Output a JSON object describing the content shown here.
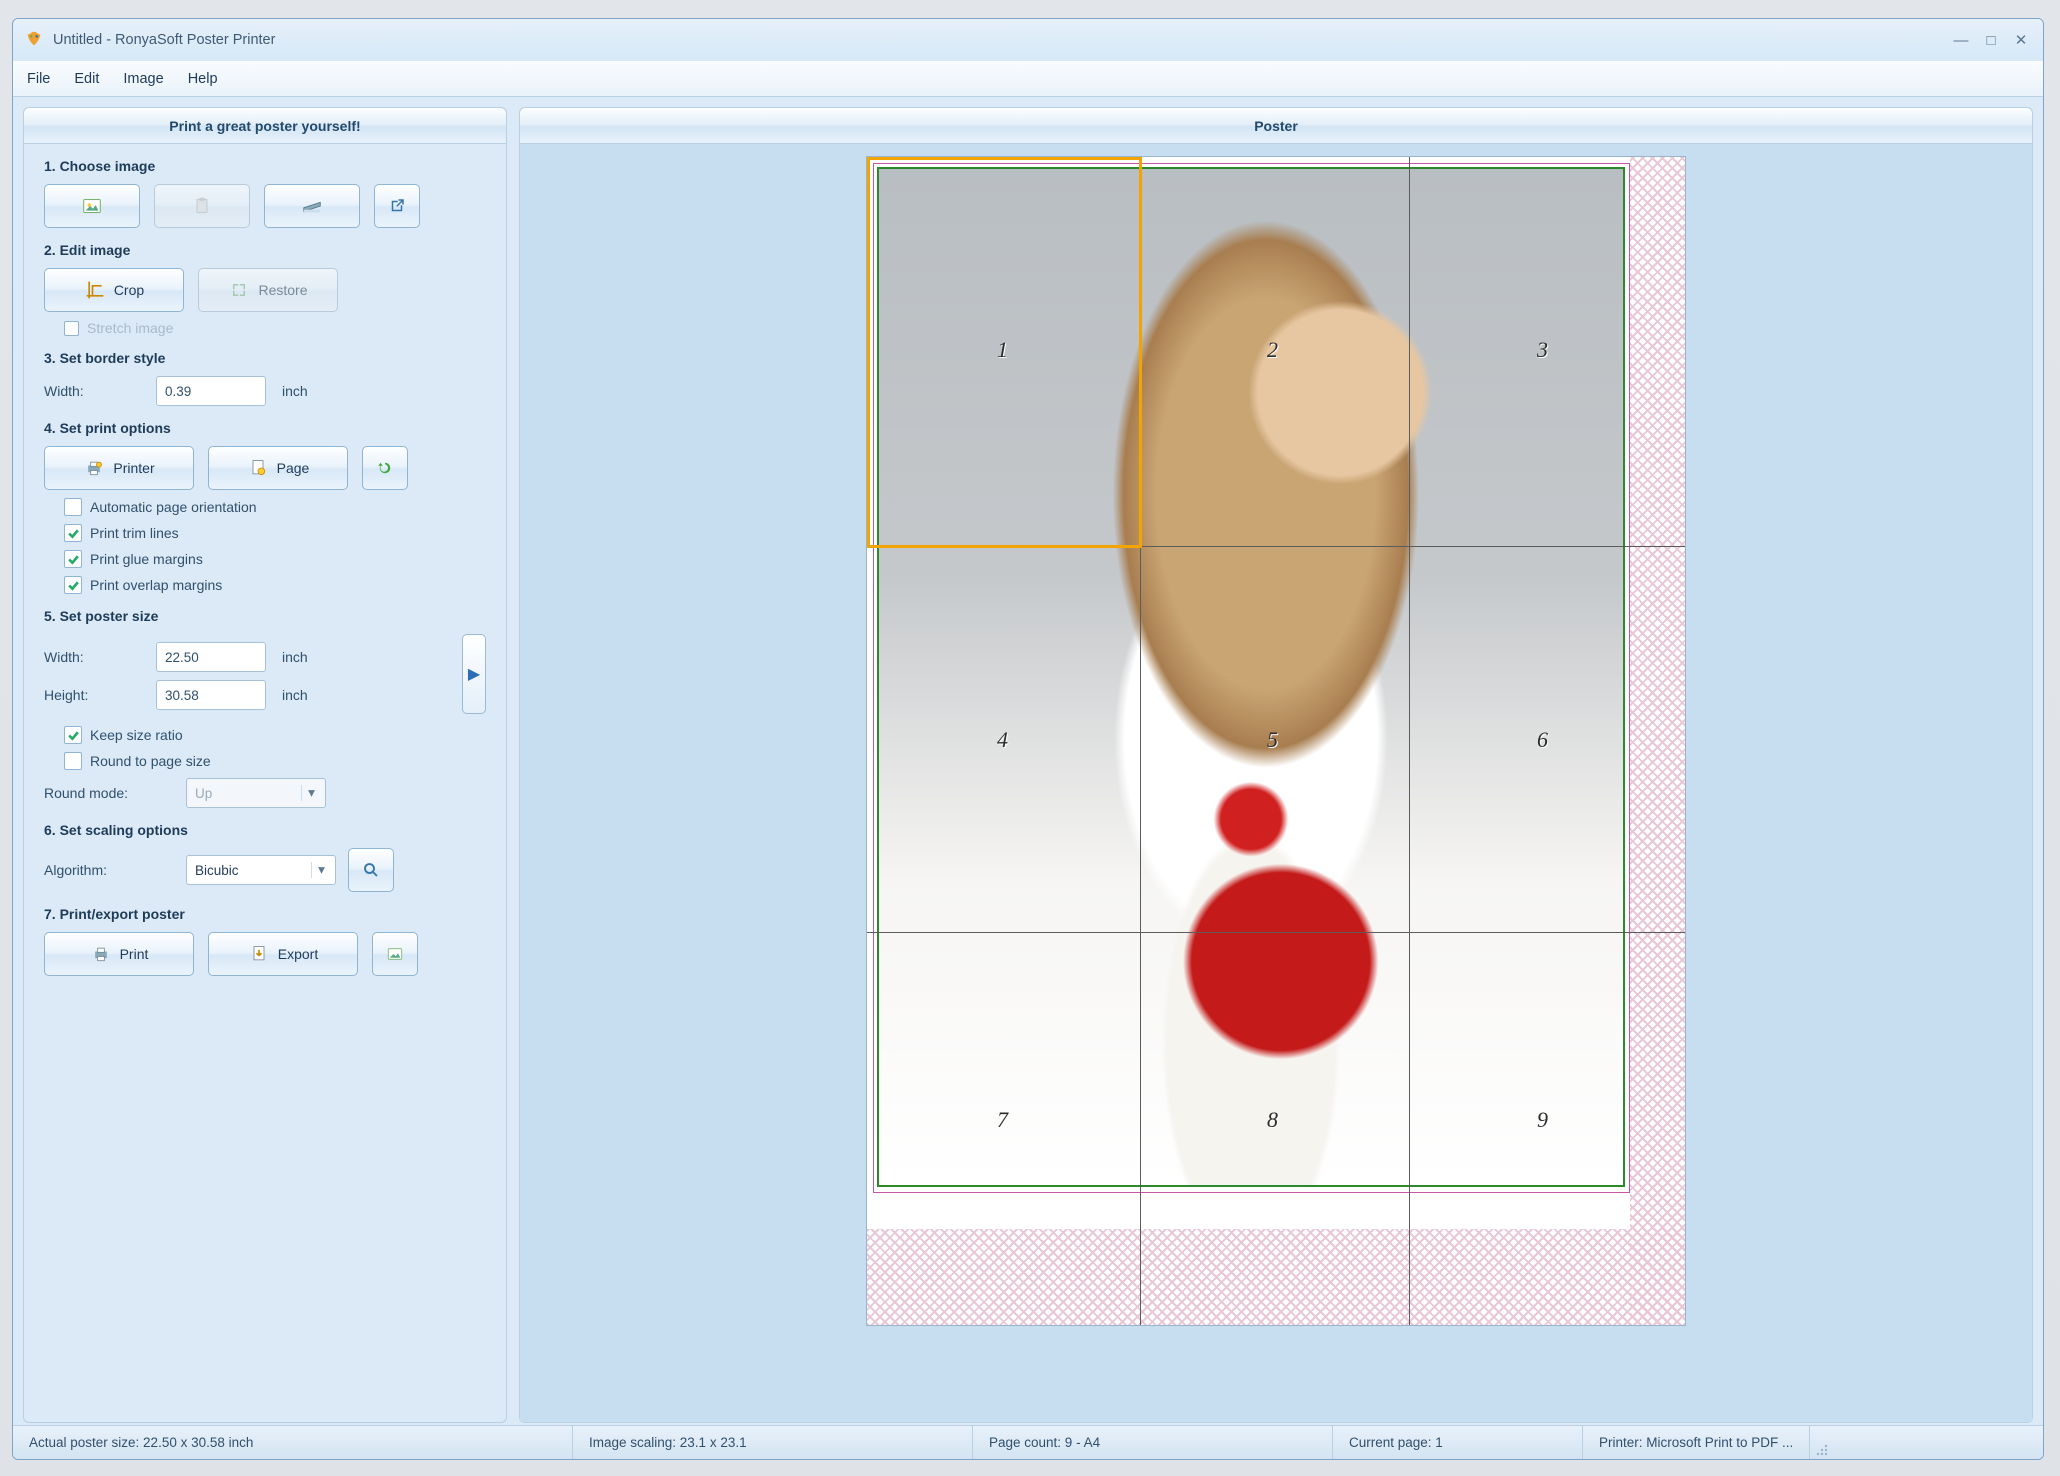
{
  "window": {
    "title": "Untitled - RonyaSoft Poster Printer"
  },
  "menu": {
    "file": "File",
    "edit": "Edit",
    "image": "Image",
    "help": "Help"
  },
  "left_header": "Print a great poster yourself!",
  "right_header": "Poster",
  "s1": {
    "title": "1. Choose image"
  },
  "s2": {
    "title": "2. Edit image",
    "crop": "Crop",
    "restore": "Restore",
    "stretch": "Stretch image"
  },
  "s3": {
    "title": "3. Set border style",
    "width_label": "Width:",
    "width_value": "0.39",
    "unit": "inch"
  },
  "s4": {
    "title": "4. Set print options",
    "printer": "Printer",
    "page": "Page",
    "auto": "Automatic page orientation",
    "trim": "Print trim lines",
    "glue": "Print glue margins",
    "overlap": "Print overlap margins"
  },
  "s5": {
    "title": "5. Set poster size",
    "width_label": "Width:",
    "width_value": "22.50",
    "height_label": "Height:",
    "height_value": "30.58",
    "unit": "inch",
    "keep": "Keep size ratio",
    "round": "Round to page size",
    "roundmode_label": "Round mode:",
    "roundmode_value": "Up"
  },
  "s6": {
    "title": "6. Set scaling options",
    "algo_label": "Algorithm:",
    "algo_value": "Bicubic"
  },
  "s7": {
    "title": "7. Print/export poster",
    "print": "Print",
    "export": "Export"
  },
  "pages": {
    "1": "1",
    "2": "2",
    "3": "3",
    "4": "4",
    "5": "5",
    "6": "6",
    "7": "7",
    "8": "8",
    "9": "9"
  },
  "status": {
    "size": "Actual poster size: 22.50 x 30.58 inch",
    "scaling": "Image scaling: 23.1 x 23.1",
    "count": "Page count: 9 - A4",
    "current": "Current page: 1",
    "printer": "Printer: Microsoft Print to PDF ..."
  }
}
